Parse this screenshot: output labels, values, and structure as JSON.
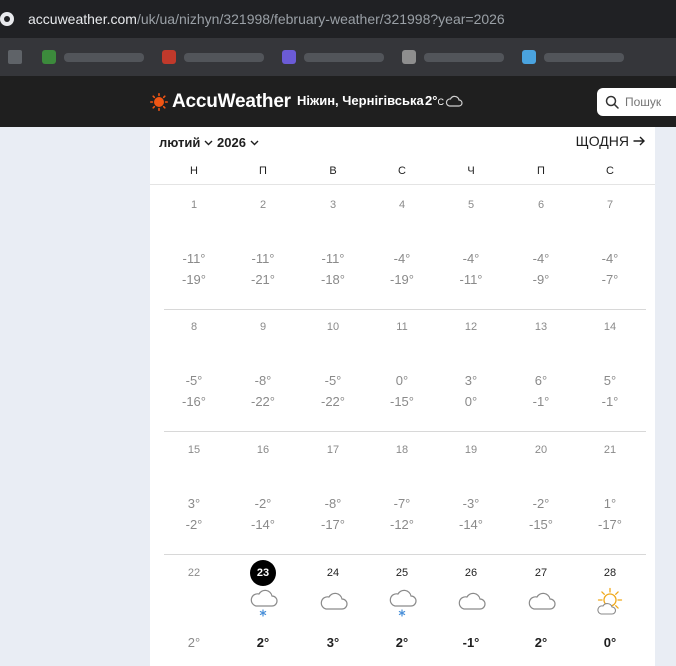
{
  "browser": {
    "url_host": "accuweather.com",
    "url_path": "/uk/ua/nizhyn/321998/february-weather/321998?year=2026",
    "bookmarks": [
      {
        "color": "#3c8a3c"
      },
      {
        "color": "#c0392b"
      },
      {
        "color": "#6b5bd6"
      },
      {
        "color": "#8e8e8e"
      },
      {
        "color": "#4aa3df"
      }
    ]
  },
  "header": {
    "brand": "AccuWeather",
    "location": "Ніжин, Чернігівська",
    "current_temp": "2°",
    "temp_unit": "C",
    "weather_icon": "cloud-icon",
    "search_placeholder": "Пошук"
  },
  "calendar": {
    "month": "лютий",
    "year": "2026",
    "daily_link": "ЩОДНЯ",
    "weekdays": [
      "Н",
      "П",
      "В",
      "С",
      "Ч",
      "П",
      "С"
    ],
    "weeks": [
      [
        {
          "day": "1",
          "hi": "-11°",
          "lo": "-19°"
        },
        {
          "day": "2",
          "hi": "-11°",
          "lo": "-21°"
        },
        {
          "day": "3",
          "hi": "-11°",
          "lo": "-18°"
        },
        {
          "day": "4",
          "hi": "-4°",
          "lo": "-19°"
        },
        {
          "day": "5",
          "hi": "-4°",
          "lo": "-11°"
        },
        {
          "day": "6",
          "hi": "-4°",
          "lo": "-9°"
        },
        {
          "day": "7",
          "hi": "-4°",
          "lo": "-7°"
        }
      ],
      [
        {
          "day": "8",
          "hi": "-5°",
          "lo": "-16°"
        },
        {
          "day": "9",
          "hi": "-8°",
          "lo": "-22°"
        },
        {
          "day": "10",
          "hi": "-5°",
          "lo": "-22°"
        },
        {
          "day": "11",
          "hi": "0°",
          "lo": "-15°"
        },
        {
          "day": "12",
          "hi": "3°",
          "lo": "0°"
        },
        {
          "day": "13",
          "hi": "6°",
          "lo": "-1°"
        },
        {
          "day": "14",
          "hi": "5°",
          "lo": "-1°"
        }
      ],
      [
        {
          "day": "15",
          "hi": "3°",
          "lo": "-2°"
        },
        {
          "day": "16",
          "hi": "-2°",
          "lo": "-14°"
        },
        {
          "day": "17",
          "hi": "-8°",
          "lo": "-17°"
        },
        {
          "day": "18",
          "hi": "-7°",
          "lo": "-12°"
        },
        {
          "day": "19",
          "hi": "-3°",
          "lo": "-14°"
        },
        {
          "day": "20",
          "hi": "-2°",
          "lo": "-15°"
        },
        {
          "day": "21",
          "hi": "1°",
          "lo": "-17°"
        }
      ],
      [
        {
          "day": "22",
          "hi": "2°",
          "lo": "",
          "icon": "",
          "style": "past"
        },
        {
          "day": "23",
          "hi": "2°",
          "lo": "",
          "icon": "cloud-snow-icon",
          "style": "today"
        },
        {
          "day": "24",
          "hi": "3°",
          "lo": "",
          "icon": "cloud-icon",
          "style": "future"
        },
        {
          "day": "25",
          "hi": "2°",
          "lo": "",
          "icon": "cloud-snow-icon",
          "style": "future"
        },
        {
          "day": "26",
          "hi": "-1°",
          "lo": "",
          "icon": "cloud-icon",
          "style": "future"
        },
        {
          "day": "27",
          "hi": "2°",
          "lo": "",
          "icon": "cloud-icon",
          "style": "future"
        },
        {
          "day": "28",
          "hi": "0°",
          "lo": "",
          "icon": "partly-sunny-icon",
          "style": "future"
        }
      ]
    ]
  }
}
